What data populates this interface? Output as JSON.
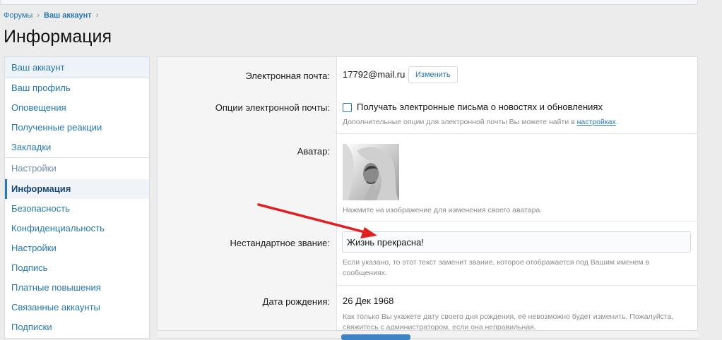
{
  "breadcrumb": {
    "items": [
      "Форумы",
      "Ваш аккаунт"
    ]
  },
  "page": {
    "title": "Информация"
  },
  "sidebar": {
    "sections": [
      {
        "heading": "Ваш аккаунт",
        "items": [
          "Ваш профиль",
          "Оповещения",
          "Полученные реакции",
          "Закладки"
        ]
      },
      {
        "heading": "Настройки",
        "items": [
          "Информация",
          "Безопасность",
          "Конфиденциальность",
          "Настройки",
          "Подпись",
          "Платные повышения",
          "Связанные аккаунты",
          "Подписки"
        ]
      }
    ],
    "active_item": "Информация"
  },
  "form": {
    "email": {
      "label": "Электронная почта:",
      "value": "17792@mail.ru",
      "change_label": "Изменить"
    },
    "email_options": {
      "label": "Опции электронной почты:",
      "checkbox_label": "Получать электронные письма о новостях и обновлениях",
      "checked": false,
      "hint": "Дополнительные опции для электронной почты Вы можете найти в ",
      "hint_link": "настройках",
      "hint_end": "."
    },
    "avatar": {
      "label": "Аватар:",
      "hint": "Нажмите на изображение для изменения своего аватара."
    },
    "custom_title": {
      "label": "Нестандартное звание:",
      "value": "Жизнь прекрасна!",
      "hint": "Если указано, то этот текст заменит звание, которое отображается под Вашим именем в сообщениях."
    },
    "dob": {
      "label": "Дата рождения:",
      "value": "26 Дек 1968",
      "hint": "Как только Вы укажете дату своего дня рождения, её невозможно будет изменить. Пожалуйста, свяжитесь с администратором, если она неправильная."
    }
  },
  "colors": {
    "accent": "#2577b1",
    "arrow": "#e02020"
  }
}
